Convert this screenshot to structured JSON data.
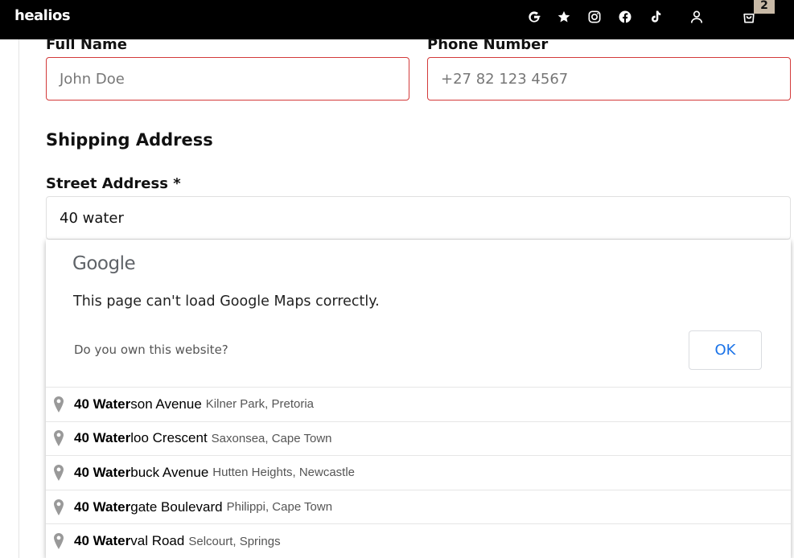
{
  "header": {
    "logo": "healios",
    "icons": [
      "google-icon",
      "star-icon",
      "instagram-icon",
      "facebook-icon",
      "tiktok-icon",
      "user-icon",
      "cart-icon"
    ],
    "cart_count": "2",
    "colors": {
      "background": "#000000",
      "badge": "#c8b9a6"
    }
  },
  "form": {
    "full_name": {
      "label": "Full Name",
      "placeholder": "John Doe"
    },
    "phone": {
      "label": "Phone Number",
      "placeholder": "+27 82 123 4567"
    },
    "shipping_title": "Shipping Address",
    "street": {
      "label": "Street Address *",
      "value": "40 water"
    },
    "error_color": "#d33a3a"
  },
  "maps_error": {
    "brand": "Google",
    "message": "This page can't load Google Maps correctly.",
    "question": "Do you own this website?",
    "ok_label": "OK"
  },
  "suggestions": [
    {
      "match": "40 Water",
      "rest": "son Avenue",
      "secondary": "Kilner Park, Pretoria"
    },
    {
      "match": "40 Water",
      "rest": "loo Crescent",
      "secondary": "Saxonsea, Cape Town"
    },
    {
      "match": "40 Water",
      "rest": "buck Avenue",
      "secondary": "Hutten Heights, Newcastle"
    },
    {
      "match": "40 Water",
      "rest": "gate Boulevard",
      "secondary": "Philippi, Cape Town"
    },
    {
      "match": "40 Water",
      "rest": "val Road",
      "secondary": "Selcourt, Springs"
    }
  ]
}
